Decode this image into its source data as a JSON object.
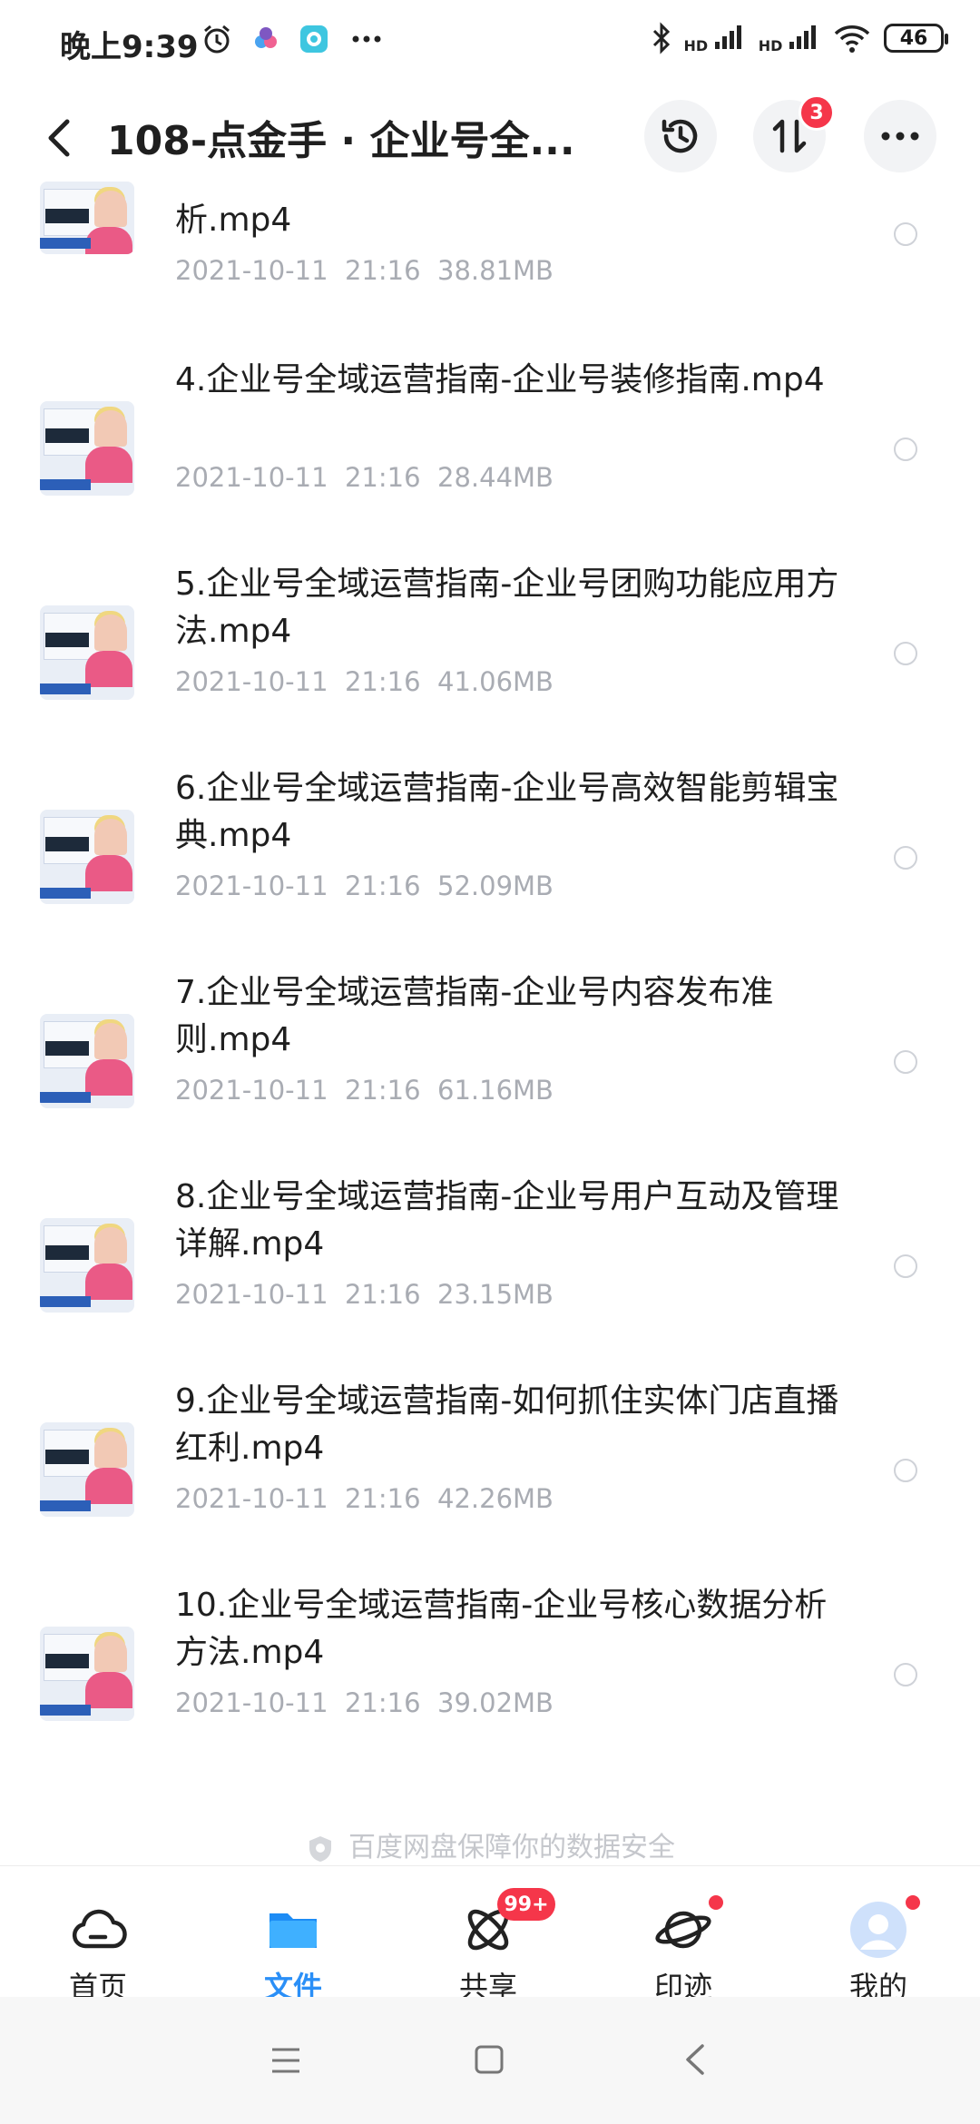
{
  "status": {
    "time": "晚上9:39",
    "battery": "46",
    "sig1": "HD",
    "sig2": "HD"
  },
  "header": {
    "title": "108-点金手 · 企业号全...",
    "transfer_badge": "3"
  },
  "files": [
    {
      "name": "析.mp4",
      "date": "2021-10-11",
      "time": "21:16",
      "size": "38.81MB"
    },
    {
      "name": "4.企业号全域运营指南-企业号装修指南.mp4",
      "date": "2021-10-11",
      "time": "21:16",
      "size": "28.44MB"
    },
    {
      "name": "5.企业号全域运营指南-企业号团购功能应用方法.mp4",
      "date": "2021-10-11",
      "time": "21:16",
      "size": "41.06MB"
    },
    {
      "name": "6.企业号全域运营指南-企业号高效智能剪辑宝典.mp4",
      "date": "2021-10-11",
      "time": "21:16",
      "size": "52.09MB"
    },
    {
      "name": "7.企业号全域运营指南-企业号内容发布准则.mp4",
      "date": "2021-10-11",
      "time": "21:16",
      "size": "61.16MB"
    },
    {
      "name": "8.企业号全域运营指南-企业号用户互动及管理详解.mp4",
      "date": "2021-10-11",
      "time": "21:16",
      "size": "23.15MB"
    },
    {
      "name": "9.企业号全域运营指南-如何抓住实体门店直播红利.mp4",
      "date": "2021-10-11",
      "time": "21:16",
      "size": "42.26MB"
    },
    {
      "name": "10.企业号全域运营指南-企业号核心数据分析方法.mp4",
      "date": "2021-10-11",
      "time": "21:16",
      "size": "39.02MB"
    }
  ],
  "footer_note": "百度网盘保障你的数据安全",
  "tabs": [
    {
      "label": "首页"
    },
    {
      "label": "文件"
    },
    {
      "label": "共享",
      "badge": "99+"
    },
    {
      "label": "印迹"
    },
    {
      "label": "我的"
    }
  ],
  "colors": {
    "accent": "#2a8ff7",
    "badge": "#f5364a",
    "meta": "#a9acb3"
  }
}
